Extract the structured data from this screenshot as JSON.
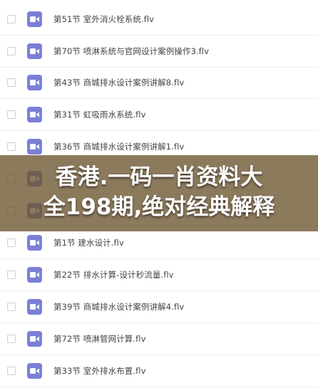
{
  "file_list": {
    "items": [
      {
        "name": "第51节 室外消火栓系统.flv",
        "icon": "video-file-icon"
      },
      {
        "name": "第70节 喷淋系统与官网设计案例操作3.flv",
        "icon": "video-file-icon"
      },
      {
        "name": "第43节 商城排水设计案例讲解8.flv",
        "icon": "video-file-icon"
      },
      {
        "name": "第31节 虹吸雨水系统.flv",
        "icon": "video-file-icon"
      },
      {
        "name": "第36节 商城排水设计案例讲解1.flv",
        "icon": "video-file-icon"
      },
      {
        "name": "",
        "icon": "video-file-icon"
      },
      {
        "name": "",
        "icon": "video-file-icon"
      },
      {
        "name": "第1节 建水设计.flv",
        "icon": "video-file-icon"
      },
      {
        "name": "第22节 排水计算-设计秒流量.flv",
        "icon": "video-file-icon"
      },
      {
        "name": "第39节 商城排水设计案例讲解4.flv",
        "icon": "video-file-icon"
      },
      {
        "name": "第72节 喷淋管网计算.flv",
        "icon": "video-file-icon"
      },
      {
        "name": "第33节 室外排水布置.flv",
        "icon": "video-file-icon"
      }
    ]
  },
  "promo_banner": {
    "line1": "香港.一码一肖资料大",
    "line2": "全198期,绝对经典解释"
  },
  "colors": {
    "icon_bg": "#7b7fd6",
    "banner_bg": "#6b5430"
  }
}
